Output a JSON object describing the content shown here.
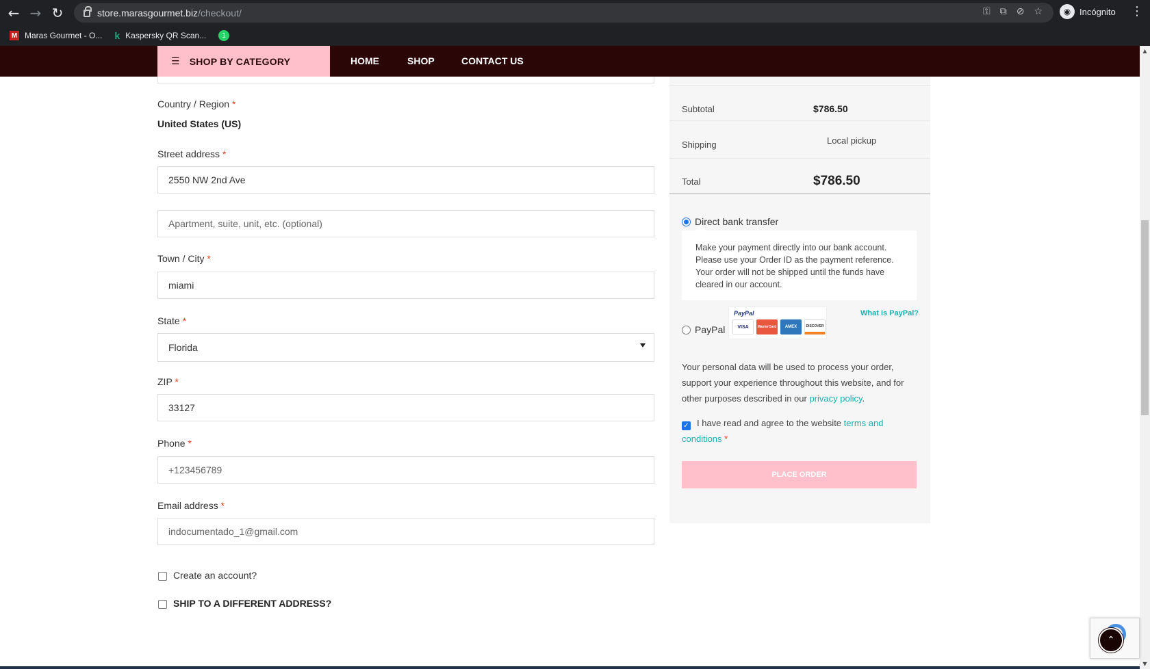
{
  "browser": {
    "url_host": "store.marasgourmet.biz",
    "url_path": "/checkout/",
    "profile_label": "Incógnito",
    "bookmarks": [
      {
        "label": "Maras Gourmet - O..."
      },
      {
        "label": "Kaspersky QR Scan..."
      }
    ],
    "whatsapp_badge": "1"
  },
  "site_nav": {
    "category_label": "SHOP BY CATEGORY",
    "links": [
      "HOME",
      "SHOP",
      "CONTACT US"
    ]
  },
  "form": {
    "country": {
      "label": "Country / Region",
      "value": "United States (US)"
    },
    "street": {
      "label": "Street address",
      "value": "2550 NW 2nd Ave",
      "placeholder2": "Apartment, suite, unit, etc. (optional)"
    },
    "city": {
      "label": "Town / City",
      "value": "miami"
    },
    "state": {
      "label": "State",
      "value": "Florida"
    },
    "zip": {
      "label": "ZIP",
      "value": "33127"
    },
    "phone": {
      "label": "Phone",
      "placeholder": "+123456789"
    },
    "email": {
      "label": "Email address",
      "value": "indocumentado_1@gmail.com"
    },
    "required_mark": "*",
    "create_account": "Create an account?",
    "ship_different": "SHIP TO A DIFFERENT ADDRESS?"
  },
  "order": {
    "subtotal_label": "Subtotal",
    "subtotal_value": "$786.50",
    "shipping_label": "Shipping",
    "shipping_value": "Local pickup",
    "total_label": "Total",
    "total_value": "$786.50",
    "payment": {
      "bank_label": "Direct bank transfer",
      "bank_desc": "Make your payment directly into our bank account. Please use your Order ID as the payment reference. Your order will not be shipped until the funds have cleared in our account.",
      "paypal_label": "PayPal",
      "paypal_logo_word": "PayPal",
      "cards": [
        "VISA",
        "MasterCard",
        "AMEX",
        "DISCOVER"
      ],
      "what_is_paypal": "What is PayPal?"
    },
    "privacy_text": "Your personal data will be used to process your order, support your experience throughout this website, and for other purposes described in our",
    "privacy_link": "privacy policy",
    "privacy_end": ".",
    "terms_text": "I have read and agree to the website",
    "terms_link": "terms and conditions",
    "place_order": "PLACE ORDER"
  },
  "colors": {
    "nav_bg": "#2a0606",
    "accent_pink": "#ffc0cb",
    "link_teal": "#1ab0b0",
    "required_red": "#e2401c"
  }
}
